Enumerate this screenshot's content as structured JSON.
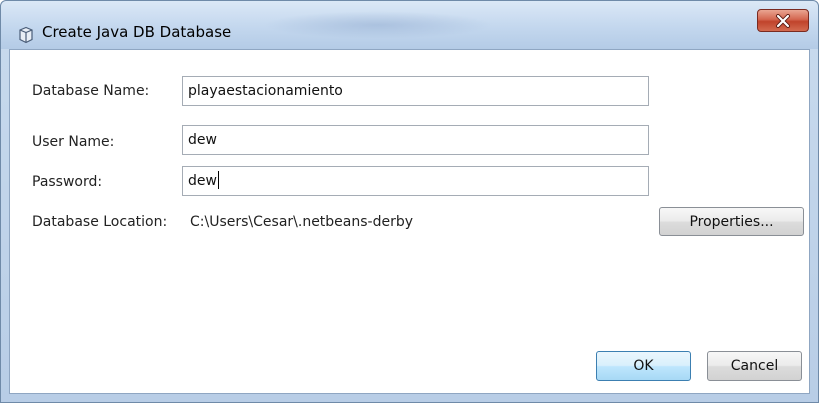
{
  "window": {
    "title": "Create Java DB Database",
    "title_icon": "java-db-icon",
    "close_icon": "close-icon"
  },
  "form": {
    "database_name_label": "Database Name:",
    "database_name_value": "playaestacionamiento",
    "user_name_label": "User Name:",
    "user_name_value": "dew",
    "password_label": "Password:",
    "password_value": "dew",
    "location_label": "Database Location:",
    "location_value": "C:\\Users\\Cesar\\.netbeans-derby",
    "properties_button": "Properties..."
  },
  "buttons": {
    "ok": "OK",
    "cancel": "Cancel"
  },
  "colors": {
    "title_bar": "#c3d7ee",
    "close_button": "#c0432b",
    "default_button": "#bee6fd"
  }
}
